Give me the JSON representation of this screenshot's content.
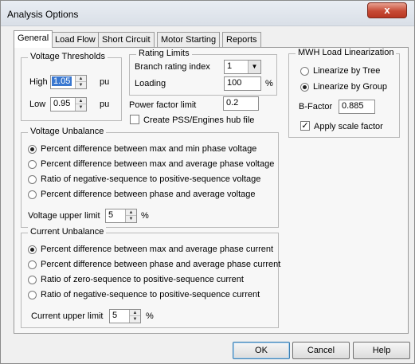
{
  "window": {
    "title": "Analysis Options",
    "close_glyph": "x"
  },
  "tabs": [
    "General",
    "Load Flow",
    "Short Circuit",
    "Motor Starting",
    "Reports"
  ],
  "voltage_thresholds": {
    "legend": "Voltage Thresholds",
    "high_label": "High",
    "high_value": "1.05",
    "high_unit": "pu",
    "low_label": "Low",
    "low_value": "0.95",
    "low_unit": "pu"
  },
  "rating_limits": {
    "legend": "Rating Limits",
    "branch_label": "Branch rating index",
    "branch_value": "1",
    "loading_label": "Loading",
    "loading_value": "100",
    "loading_unit": "%"
  },
  "power_factor": {
    "label": "Power factor limit",
    "value": "0.2"
  },
  "pss_checkbox": {
    "label": "Create PSS/Engines hub file",
    "checked": false
  },
  "mwh": {
    "legend": "MWH Load Linearization",
    "option_tree": "Linearize by Tree",
    "option_group": "Linearize by Group",
    "bfactor_label": "B-Factor",
    "bfactor_value": "0.885",
    "apply_label": "Apply scale factor",
    "apply_checked": true
  },
  "voltage_unbalance": {
    "legend": "Voltage Unbalance",
    "options": [
      "Percent difference between max and min phase voltage",
      "Percent difference between max and average phase voltage",
      "Ratio of negative-sequence to positive-sequence voltage",
      "Percent difference between phase and average voltage"
    ],
    "selected": 0,
    "limit_label": "Voltage upper limit",
    "limit_value": "5",
    "limit_unit": "%"
  },
  "current_unbalance": {
    "legend": "Current Unbalance",
    "options": [
      "Percent difference between max and average phase current",
      "Percent difference between phase and average phase current",
      "Ratio of zero-sequence to positive-sequence current",
      "Ratio of negative-sequence to positive-sequence current"
    ],
    "selected": 0,
    "limit_label": "Current upper limit",
    "limit_value": "5",
    "limit_unit": "%"
  },
  "buttons": {
    "ok": "OK",
    "cancel": "Cancel",
    "help": "Help"
  },
  "icons": {
    "spin_up": "▲",
    "spin_down": "▼",
    "combo_arrow": "▼",
    "check_mark": "✓"
  }
}
